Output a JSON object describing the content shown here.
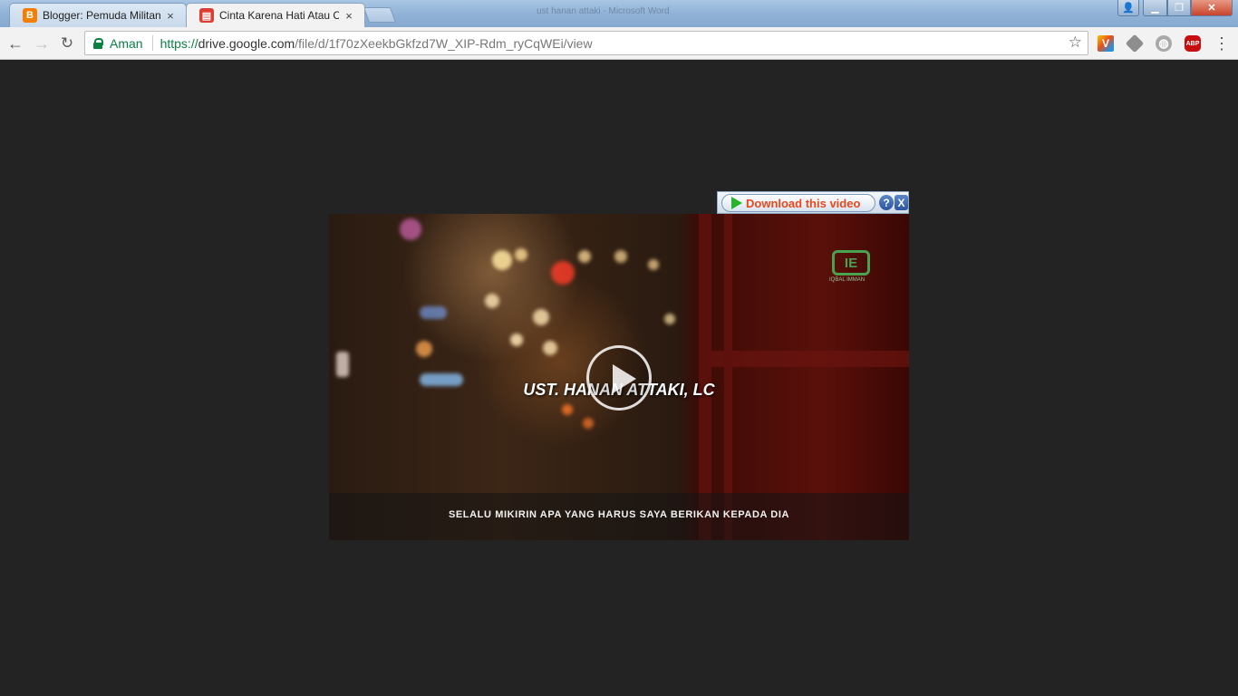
{
  "tabs": [
    {
      "title": "Blogger: Pemuda Militan",
      "close": "×"
    },
    {
      "title": "Cinta Karena Hati Atau C",
      "close": "×"
    }
  ],
  "window": {
    "title": "ust hanan attaki - Microsoft Word"
  },
  "toolbar": {
    "secure_label": "Aman",
    "url_scheme": "https://",
    "url_host": "drive.google.com",
    "url_path": "/file/d/1f70zXeekbGkfzd7W_XIP-Rdm_ryCqWEi/view",
    "abp_label": "ABP"
  },
  "video": {
    "title": "UST. HANAN ATTAKI, LC",
    "subtitle": "SELALU MIKIRIN APA YANG HARUS SAYA BERIKAN KEPADA DIA",
    "watermark_text": "IE",
    "watermark_caption": "IQBAL IMMAN"
  },
  "download_bar": {
    "label": "Download this video",
    "help": "?",
    "close": "X"
  },
  "colors": {
    "page_bg": "#232323",
    "secure_green": "#0b8043",
    "download_text": "#e8481c"
  }
}
